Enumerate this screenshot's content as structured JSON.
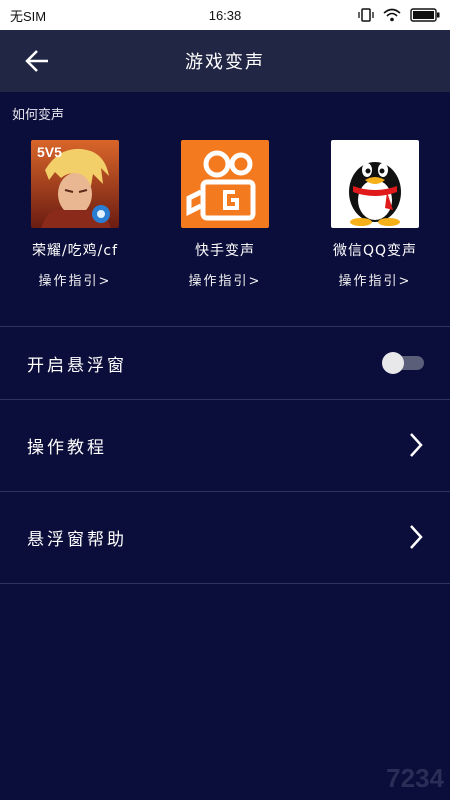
{
  "status_bar": {
    "carrier": "无SIM",
    "time": "16:38"
  },
  "header": {
    "title": "游戏变声"
  },
  "section": {
    "label": "如何变声"
  },
  "apps": [
    {
      "name": "荣耀/吃鸡/cf",
      "guide": "操作指引>",
      "icon": "game-hero-icon",
      "badge": "5V5"
    },
    {
      "name": "快手变声",
      "guide": "操作指引>",
      "icon": "kuaishou-icon",
      "color": "#f47a1f"
    },
    {
      "name": "微信QQ变声",
      "guide": "操作指引>",
      "icon": "qq-penguin-icon"
    }
  ],
  "settings": [
    {
      "label": "开启悬浮窗",
      "control": "toggle",
      "enabled": false
    },
    {
      "label": "操作教程",
      "control": "chevron"
    },
    {
      "label": "悬浮窗帮助",
      "control": "chevron"
    }
  ],
  "watermark": "7234",
  "colors": {
    "background": "#0b0d3a",
    "header": "#222645",
    "divider": "#2e3462"
  }
}
